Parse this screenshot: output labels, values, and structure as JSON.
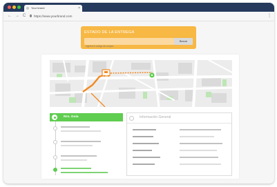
{
  "browser": {
    "tab_title": "Your brand",
    "close_glyph": "×",
    "url": "https://www.yourbrand.com",
    "menu_glyph": "⋮",
    "nav": {
      "back": "←",
      "forward": "→",
      "reload": "C"
    }
  },
  "status_card": {
    "title": "ESTADO DE LA ENTREGA",
    "input_placeholder": "Ingrese el código de compra",
    "search_label": "Buscar"
  },
  "tracking": {
    "header": "Nro. Guia"
  },
  "info": {
    "title": "Información General"
  },
  "colors": {
    "brand_navy": "#253a5c",
    "accent_orange": "#f7b844",
    "accent_green": "#5fcd50",
    "route_orange": "#f08a24"
  },
  "icons": {
    "map_truck": "truck-icon",
    "map_pin": "location-pin-icon"
  }
}
